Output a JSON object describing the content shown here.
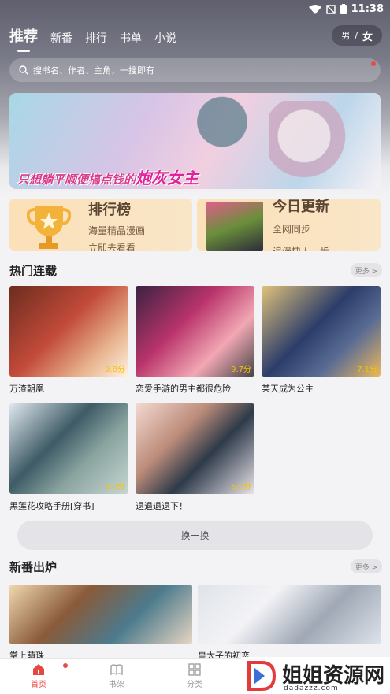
{
  "status_bar": {
    "time": "11:38"
  },
  "tabs": [
    {
      "label": "推荐",
      "active": true
    },
    {
      "label": "新番"
    },
    {
      "label": "排行"
    },
    {
      "label": "书单"
    },
    {
      "label": "小说"
    }
  ],
  "gender": {
    "male": "男",
    "sep": "/",
    "female": "女"
  },
  "search": {
    "placeholder": "搜书名、作者、主角，一搜即有"
  },
  "banner": {
    "text_prefix": "只想躺平顺便搞点钱的",
    "text_highlight": "炮灰女主"
  },
  "features": {
    "rank": {
      "title": "排行榜",
      "sub1": "海量精品漫画",
      "sub2": "立即去看看"
    },
    "update": {
      "title": "今日更新",
      "sub1": "全网同步",
      "sub2": "追漫快人一步"
    }
  },
  "hot": {
    "title": "热门连载",
    "more": "更多 >",
    "items": [
      {
        "title": "万渣朝凰",
        "score": "9.8分"
      },
      {
        "title": "恋爱手游的男主都很危险",
        "score": "9.7分"
      },
      {
        "title": "某天成为公主",
        "score": "7.1分"
      },
      {
        "title": "黑莲花攻略手册[穿书]",
        "score": "9.0分"
      },
      {
        "title": "退退退退下！",
        "score": "6.0分"
      }
    ],
    "swap": "换一换"
  },
  "new": {
    "title": "新番出炉",
    "more": "更多 >",
    "items": [
      {
        "title": "掌上萌珠"
      },
      {
        "title": "皇太子的初恋"
      }
    ]
  },
  "nav": [
    {
      "label": "首页",
      "active": true
    },
    {
      "label": "书架"
    },
    {
      "label": "分类"
    }
  ],
  "watermark": {
    "text": "姐姐资源网",
    "sub": "dadazzz.com"
  },
  "colors": {
    "accent": "#e4483f",
    "score": "#f5c200"
  }
}
